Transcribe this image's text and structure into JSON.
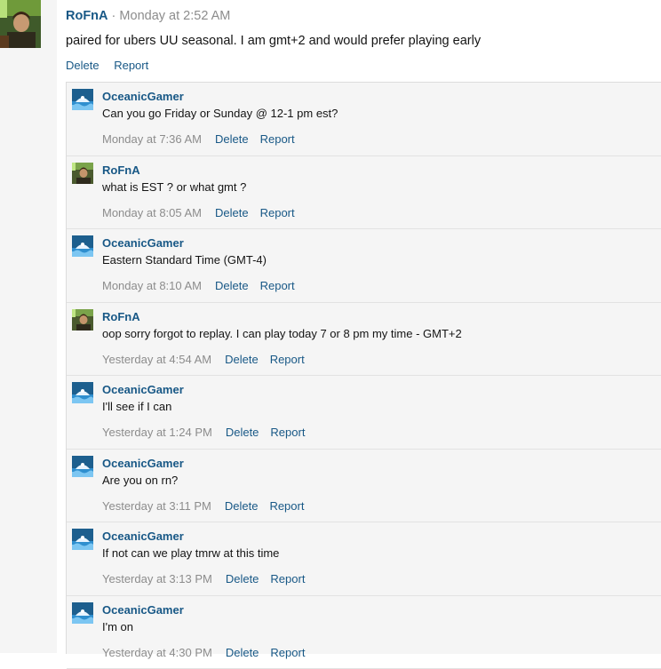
{
  "main_post": {
    "author": "RoFnA",
    "separator": "·",
    "timestamp": "Monday at 2:52 AM",
    "message": "paired for ubers UU seasonal. I am gmt+2 and would prefer playing early",
    "delete_label": "Delete",
    "report_label": "Report"
  },
  "comments": [
    {
      "author": "OceanicGamer",
      "message": "Can you go Friday or Sunday @ 12-1 pm est?",
      "timestamp": "Monday at 7:36 AM",
      "delete_label": "Delete",
      "report_label": "Report"
    },
    {
      "author": "RoFnA",
      "message": "what is EST ? or what gmt ?",
      "timestamp": "Monday at 8:05 AM",
      "delete_label": "Delete",
      "report_label": "Report"
    },
    {
      "author": "OceanicGamer",
      "message": "Eastern Standard Time (GMT-4)",
      "timestamp": "Monday at 8:10 AM",
      "delete_label": "Delete",
      "report_label": "Report"
    },
    {
      "author": "RoFnA",
      "message": "oop sorry forgot to replay. I can play today 7 or 8 pm my time - GMT+2",
      "timestamp": "Yesterday at 4:54 AM",
      "delete_label": "Delete",
      "report_label": "Report"
    },
    {
      "author": "OceanicGamer",
      "message": "I'll see if I can",
      "timestamp": "Yesterday at 1:24 PM",
      "delete_label": "Delete",
      "report_label": "Report"
    },
    {
      "author": "OceanicGamer",
      "message": "Are you on rn?",
      "timestamp": "Yesterday at 3:11 PM",
      "delete_label": "Delete",
      "report_label": "Report"
    },
    {
      "author": "OceanicGamer",
      "message": "If not can we play tmrw at this time",
      "timestamp": "Yesterday at 3:13 PM",
      "delete_label": "Delete",
      "report_label": "Report"
    },
    {
      "author": "OceanicGamer",
      "message": "I'm on",
      "timestamp": "Yesterday at 4:30 PM",
      "delete_label": "Delete",
      "report_label": "Report"
    }
  ],
  "colors": {
    "link": "#185886",
    "muted": "#8c8c8c",
    "panel_bg": "#f5f5f5",
    "border": "#dcdcdc"
  }
}
